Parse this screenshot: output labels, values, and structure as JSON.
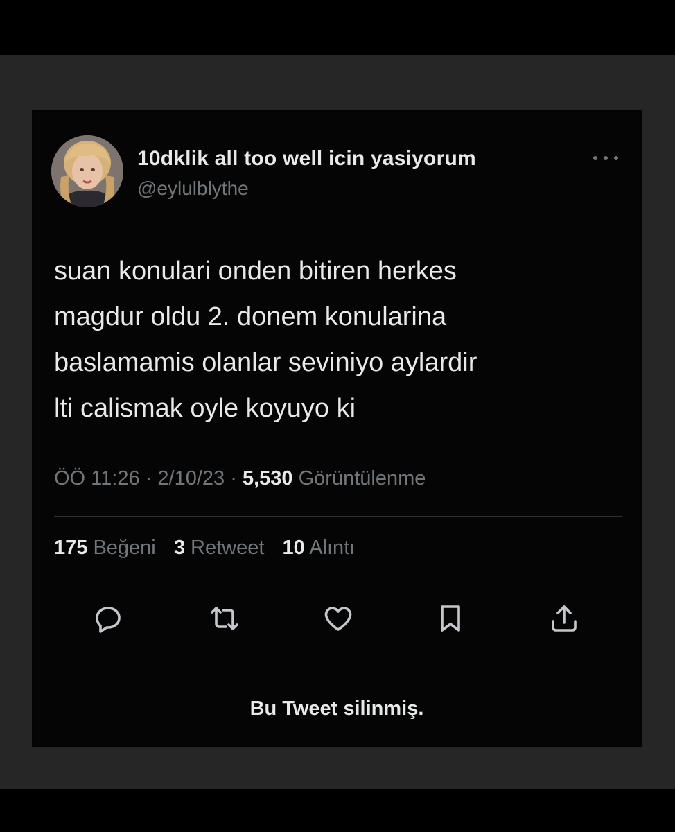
{
  "tweet": {
    "display_name": "10dklik all too well icin yasiyorum",
    "handle": "@eylulblythe",
    "text_lines": [
      "suan konulari onden bitiren herkes",
      "magdur oldu 2. donem konularina",
      "baslamamis olanlar seviniyo aylardir",
      "lti calismak oyle koyuyo ki"
    ],
    "time": "ÖÖ 11:26",
    "separator": "·",
    "date": "2/10/23",
    "views_count": "5,530",
    "views_label": "Görüntülenme"
  },
  "stats": {
    "likes_count": "175",
    "likes_label": "Beğeni",
    "retweets_count": "3",
    "retweets_label": "Retweet",
    "quotes_count": "10",
    "quotes_label": "Alıntı"
  },
  "actions": [
    "reply-icon",
    "retweet-icon",
    "like-icon",
    "bookmark-icon",
    "share-icon"
  ],
  "notice": "Bu Tweet silinmiş.",
  "colors": {
    "background": "#000000",
    "frame": "#262626",
    "card": "#050505",
    "primary_text": "#e7e9ea",
    "secondary_text": "#71767b",
    "divider": "#2f3336"
  }
}
